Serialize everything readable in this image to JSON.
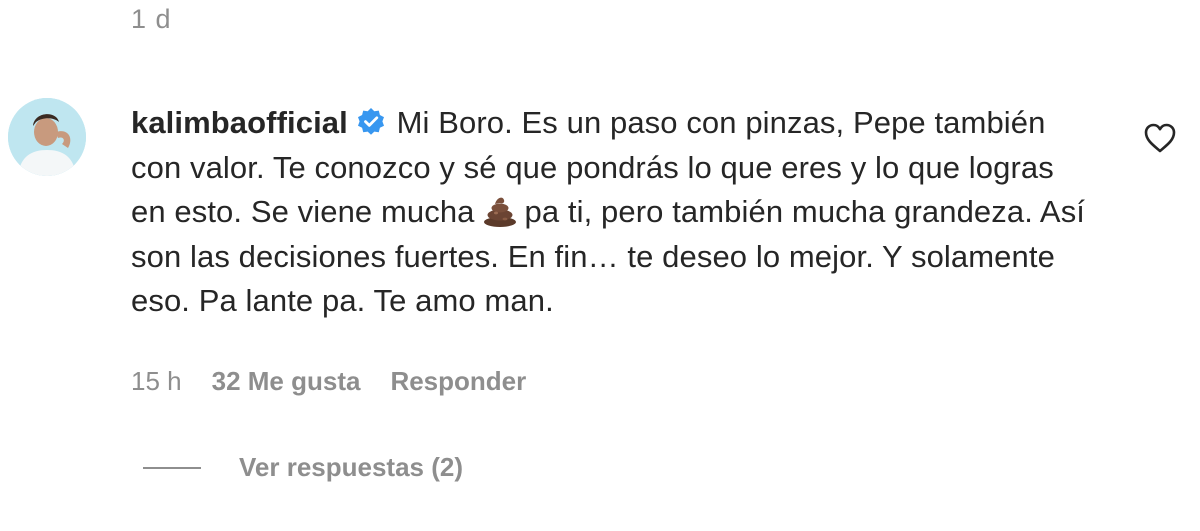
{
  "previous_comment": {
    "time": "1 d"
  },
  "comment": {
    "username": "kalimbaofficial",
    "verified_icon": "verified-badge-icon",
    "text_part1": "Mi Boro. Es un paso con pinzas, Pepe también con valor. Te conozco y sé que pondrás lo que eres y lo que logras en esto. Se viene mucha",
    "emoji": "pile-of-poo-emoji",
    "text_part2": "pa ti, pero también mucha grandeza. Así son las decisiones fuertes. En fin… te deseo lo mejor. Y solamente eso. Pa lante pa. Te amo man.",
    "time": "15 h",
    "likes": "32 Me gusta",
    "reply_label": "Responder",
    "view_replies": "Ver respuestas (2)",
    "like_icon": "heart-outline-icon"
  },
  "colors": {
    "text": "#262626",
    "muted": "#8e8e8e",
    "verified": "#3897f0"
  }
}
